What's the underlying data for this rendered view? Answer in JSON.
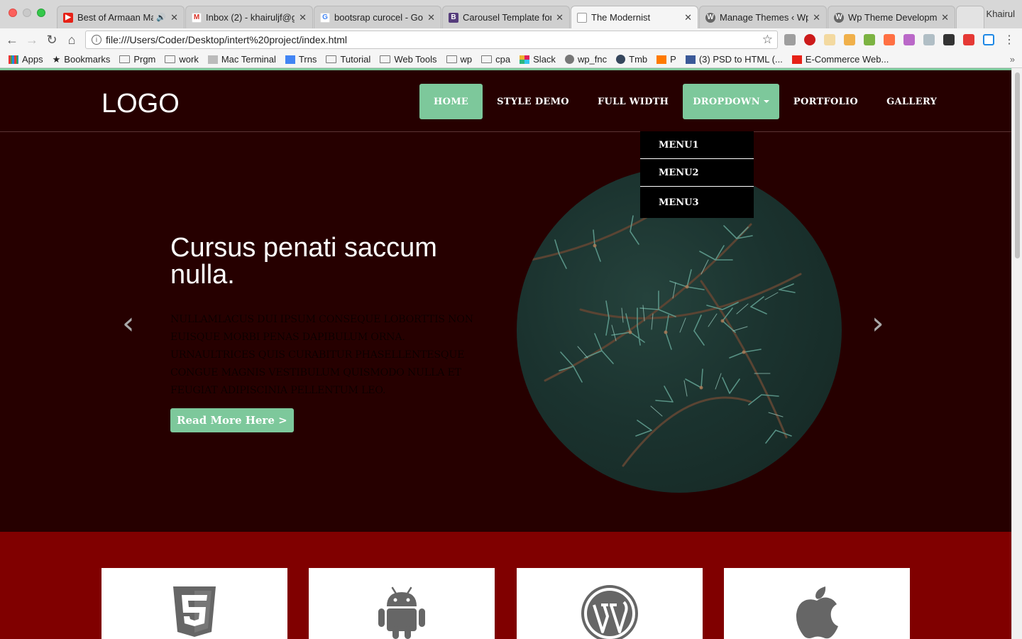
{
  "browser": {
    "tabs": [
      {
        "title": "Best of Armaan Ma",
        "icon": "youtube-icon",
        "color": "#e62117"
      },
      {
        "title": "Inbox (2) - khairuljf@g",
        "icon": "gmail-icon",
        "color": "#d93025"
      },
      {
        "title": "bootsrap curocel - Go",
        "icon": "google-icon",
        "color": "#4285f4"
      },
      {
        "title": "Carousel Template for",
        "icon": "bootstrap-icon",
        "color": "#563d7c"
      },
      {
        "title": "The Modernist",
        "icon": "page-icon",
        "color": "#ffffff",
        "active": true
      },
      {
        "title": "Manage Themes ‹ Wp",
        "icon": "wordpress-icon",
        "color": "#666666"
      },
      {
        "title": "Wp Theme Developm",
        "icon": "wordpress-icon",
        "color": "#666666"
      }
    ],
    "profile_name": "Khairul",
    "url": "file:///Users/Coder/Desktop/intert%20project/index.html",
    "bookmarks": [
      {
        "label": "Apps",
        "icon": "apps-grid-icon"
      },
      {
        "label": "Bookmarks",
        "icon": "star-icon"
      },
      {
        "label": "Prgm",
        "icon": "folder-icon"
      },
      {
        "label": "work",
        "icon": "folder-icon"
      },
      {
        "label": "Mac Terminal",
        "icon": "page-icon"
      },
      {
        "label": "Trns",
        "icon": "translate-icon"
      },
      {
        "label": "Tutorial",
        "icon": "folder-icon"
      },
      {
        "label": "Web Tools",
        "icon": "folder-icon"
      },
      {
        "label": "wp",
        "icon": "folder-icon"
      },
      {
        "label": "cpa",
        "icon": "folder-icon"
      },
      {
        "label": "Slack",
        "icon": "slack-icon"
      },
      {
        "label": "wp_fnc",
        "icon": "wordpress-icon"
      },
      {
        "label": "Tmb",
        "icon": "tumblr-icon"
      },
      {
        "label": "P",
        "icon": "p-icon"
      },
      {
        "label": "(3) PSD to HTML (...",
        "icon": "facebook-icon"
      },
      {
        "label": "E-Commerce Web...",
        "icon": "youtube-icon"
      }
    ],
    "overflow_label": "»"
  },
  "site": {
    "logo": "LOGO",
    "nav": [
      {
        "label": "Home",
        "state": "active"
      },
      {
        "label": "Style Demo",
        "state": "normal"
      },
      {
        "label": "Full Width",
        "state": "normal"
      },
      {
        "label": "Dropdown",
        "state": "open"
      },
      {
        "label": "Portfolio",
        "state": "normal"
      },
      {
        "label": "Gallery",
        "state": "normal"
      }
    ],
    "dropdown_items": [
      "Menu1",
      "Menu2",
      "Menu3"
    ],
    "hero": {
      "title": "Cursus penati saccum nulla.",
      "text": "Nullamlacus dui ipsum conseque loborttis non euisque morbi penas dapibulum orna. Urnaultrices quis curabitur phasellentesque congue magnis vestibulum quismodo nulla et feugiat adipiscinia pellentum leo.",
      "button": "Read More Here >",
      "prev": "‹",
      "next": "›"
    },
    "features": [
      {
        "icon": "html5-icon"
      },
      {
        "icon": "android-icon"
      },
      {
        "icon": "wordpress-icon"
      },
      {
        "icon": "apple-icon"
      }
    ],
    "colors": {
      "accent": "#7dc89b",
      "header_bg": "#260000",
      "features_bg": "#800000",
      "dropdown_bg": "#000000",
      "icon_gray": "#666666"
    }
  }
}
